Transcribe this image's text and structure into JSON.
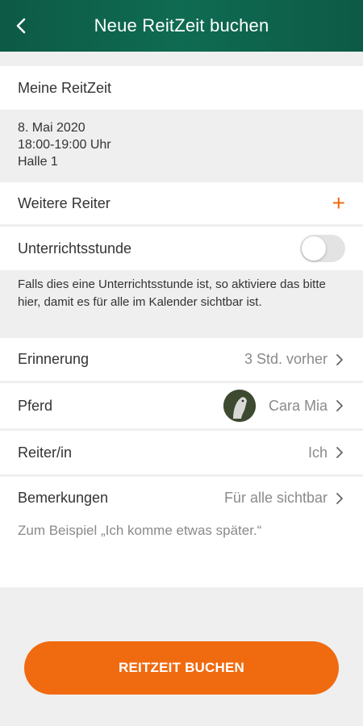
{
  "header": {
    "title": "Neue ReitZeit buchen",
    "back_icon": "chevron-left-icon"
  },
  "my_time": {
    "label": "Meine ReitZeit",
    "date": "8. Mai 2020",
    "time": "18:00-19:00 Uhr",
    "location": "Halle 1"
  },
  "more_riders": {
    "label": "Weitere Reiter",
    "add_symbol": "+"
  },
  "lesson": {
    "label": "Unterrichtsstunde",
    "enabled": false,
    "hint": "Falls dies eine Unterrichtsstunde ist, so aktiviere das bitte hier, damit es für alle im Kalender sichtbar ist."
  },
  "reminder": {
    "label": "Erinnerung",
    "value": "3 Std. vorher"
  },
  "horse": {
    "label": "Pferd",
    "value": "Cara Mia"
  },
  "rider": {
    "label": "Reiter/in",
    "value": "Ich"
  },
  "notes": {
    "label": "Bemerkungen",
    "value": "Für alle sichtbar",
    "placeholder": "Zum Beispiel „Ich komme etwas später.“"
  },
  "cta": {
    "label": "REITZEIT BUCHEN"
  },
  "colors": {
    "header": "#0f6b52",
    "accent": "#f06a10",
    "background": "#efefef"
  }
}
